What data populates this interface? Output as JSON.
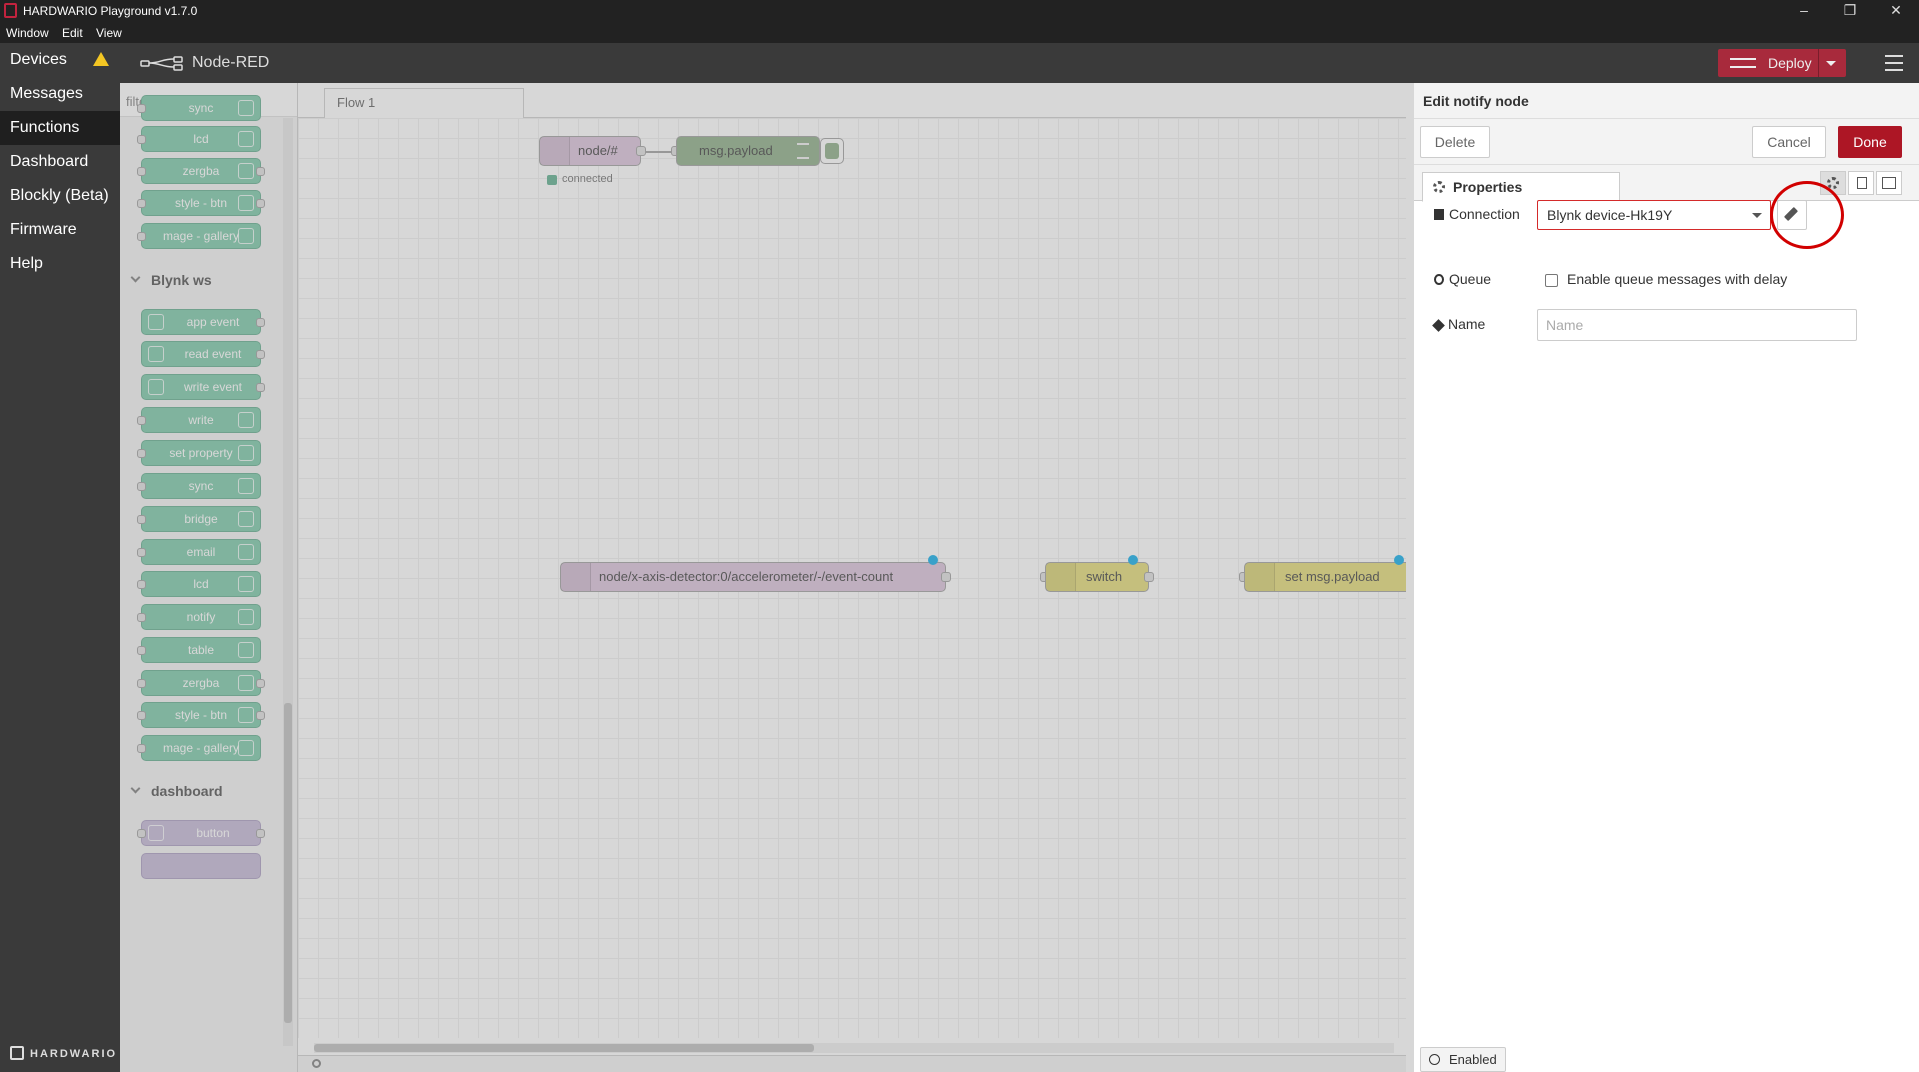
{
  "window": {
    "title": "HARDWARIO Playground v1.7.0"
  },
  "menu": {
    "window": "Window",
    "edit": "Edit",
    "view": "View"
  },
  "nav": {
    "items": [
      {
        "label": "Devices",
        "warning": true
      },
      {
        "label": "Messages"
      },
      {
        "label": "Functions",
        "active": true
      },
      {
        "label": "Dashboard"
      },
      {
        "label": "Blockly (Beta)"
      },
      {
        "label": "Firmware"
      },
      {
        "label": "Help"
      }
    ],
    "brand": "HARDWARIO"
  },
  "header": {
    "title": "Node-RED",
    "deploy_label": "Deploy"
  },
  "palette": {
    "filter_placeholder": "filter nodes",
    "top_nodes": [
      "sync",
      "lcd",
      "zergba",
      "style - btn",
      "mage - gallery"
    ],
    "category_blynk": "Blynk ws",
    "blynk_nodes": [
      "app event",
      "read event",
      "write event",
      "write",
      "set property",
      "sync",
      "bridge",
      "email",
      "lcd",
      "notify",
      "table",
      "zergba",
      "style - btn",
      "mage - gallery"
    ],
    "category_dashboard": "dashboard",
    "dashboard_nodes": [
      "button"
    ]
  },
  "workspace": {
    "tab": "Flow 1",
    "nodes": {
      "mqtt_in_1": "node/#",
      "debug_1": "msg.payload",
      "status_1": "connected",
      "mqtt_in_2": "node/x-axis-detector:0/accelerometer/-/event-count",
      "switch_1": "switch",
      "change_1": "set msg.payload"
    }
  },
  "editor": {
    "title": "Edit notify node",
    "delete": "Delete",
    "cancel": "Cancel",
    "done": "Done",
    "tab_properties": "Properties",
    "connection_label": "Connection",
    "connection_value": "Blynk device-Hk19Y",
    "queue_label": "Queue",
    "queue_checkbox_label": "Enable queue messages with delay",
    "name_label": "Name",
    "name_placeholder": "Name",
    "enabled": "Enabled"
  },
  "colors": {
    "accent": "#ad1625",
    "blynk_node": "#73c6a4",
    "highlight": "#d10000"
  }
}
